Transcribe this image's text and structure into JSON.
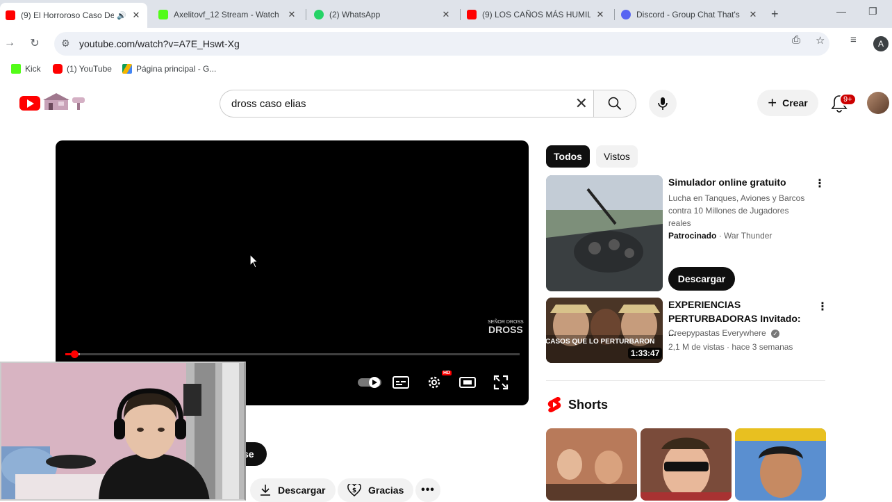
{
  "browser": {
    "tabs": [
      {
        "title": "(9) El Horroroso Caso De",
        "favicon_color": "#ff0000",
        "active": true,
        "audio": true
      },
      {
        "title": "Axelitovf_12 Stream - Watch",
        "favicon_color": "#53fc18",
        "active": false
      },
      {
        "title": "(2) WhatsApp",
        "favicon_color": "#25d366",
        "active": false
      },
      {
        "title": "(9) LOS CAÑOS MÁS HUMIL",
        "favicon_color": "#ff0000",
        "active": false
      },
      {
        "title": "Discord - Group Chat That's",
        "favicon_color": "#5865f2",
        "active": false
      }
    ],
    "url": "youtube.com/watch?v=A7E_Hswt-Xg",
    "profile_initial": "A",
    "bookmarks": [
      {
        "label": "Kick",
        "icon": "kick-icon"
      },
      {
        "label": "(1) YouTube",
        "icon": "youtube-icon"
      },
      {
        "label": "Página principal - G...",
        "icon": "drive-icon"
      }
    ]
  },
  "youtube": {
    "search_query": "dross caso elias",
    "create_label": "Crear",
    "notifications_badge": "9+",
    "player": {
      "watermark_top": "SEÑOR DROSS",
      "watermark_main": "DROSS",
      "progress": 0.02
    },
    "actions": {
      "download_label": "Descargar",
      "thanks_label": "Gracias",
      "partial_chip": "se"
    },
    "filter_chips": [
      "Todos",
      "Vistos"
    ],
    "recommendations": [
      {
        "title": "Simulador online gratuito",
        "description": "Lucha en Tanques, Aviones y Barcos contra 10 Millones de Jugadores reales",
        "sponsored_label": "Patrocinado",
        "advertiser": "War Thunder",
        "cta": "Descargar"
      },
      {
        "title": "EXPERIENCIAS PERTURBADORAS Invitado: ...",
        "channel": "Creepypastas Everywhere",
        "stats": "2,1 M de vistas · hace 3 semanas",
        "duration": "1:33:47",
        "thumb_text": "LOS CASOS QUE LO PERTURBARON"
      }
    ],
    "shorts_label": "Shorts"
  }
}
